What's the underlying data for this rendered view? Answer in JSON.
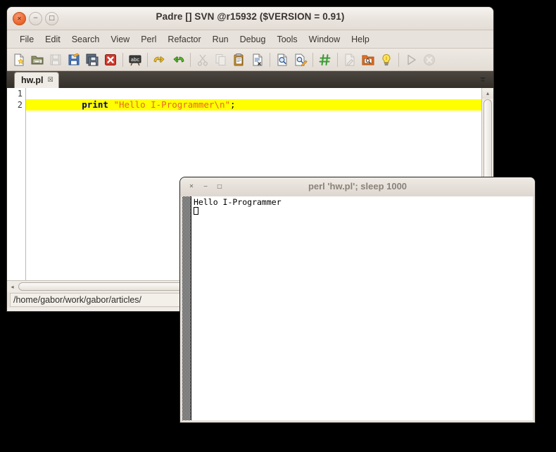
{
  "padre": {
    "title": "Padre [] SVN @r15932 ($VERSION = 0.91)",
    "window_buttons": [
      {
        "name": "close",
        "glyph": "✕"
      },
      {
        "name": "minimize",
        "glyph": "−"
      },
      {
        "name": "maximize",
        "glyph": "□"
      }
    ],
    "menus": [
      "File",
      "Edit",
      "Search",
      "View",
      "Perl",
      "Refactor",
      "Run",
      "Debug",
      "Tools",
      "Window",
      "Help"
    ],
    "toolbar": [
      {
        "icon": "new-file-icon",
        "label": "New",
        "enabled": true
      },
      {
        "icon": "open-folder-icon",
        "label": "Open",
        "enabled": true
      },
      {
        "icon": "save-icon",
        "label": "Save",
        "enabled": false
      },
      {
        "icon": "save-as-icon",
        "label": "Save As",
        "enabled": true
      },
      {
        "icon": "save-all-icon",
        "label": "Save All",
        "enabled": true
      },
      {
        "icon": "close-document-icon",
        "label": "Close",
        "enabled": true
      },
      {
        "separator": true
      },
      {
        "icon": "spell-check-icon",
        "label": "Spelling",
        "enabled": true
      },
      {
        "separator": true
      },
      {
        "icon": "undo-icon",
        "label": "Undo",
        "enabled": true
      },
      {
        "icon": "redo-icon",
        "label": "Redo",
        "enabled": true
      },
      {
        "separator": true
      },
      {
        "icon": "cut-icon",
        "label": "Cut",
        "enabled": false
      },
      {
        "icon": "copy-icon",
        "label": "Copy",
        "enabled": false
      },
      {
        "icon": "paste-icon",
        "label": "Paste",
        "enabled": true
      },
      {
        "icon": "delete-document-icon",
        "label": "Delete",
        "enabled": true
      },
      {
        "separator": true
      },
      {
        "icon": "find-icon",
        "label": "Find",
        "enabled": true
      },
      {
        "icon": "find-replace-icon",
        "label": "Replace",
        "enabled": true
      },
      {
        "separator": true
      },
      {
        "icon": "goto-line-icon",
        "label": "Goto Line",
        "enabled": true
      },
      {
        "separator": true
      },
      {
        "icon": "document-pen-icon",
        "label": "Doc Stats",
        "enabled": false
      },
      {
        "icon": "browse-folder-icon",
        "label": "Browse",
        "enabled": true
      },
      {
        "icon": "lightbulb-icon",
        "label": "Hints",
        "enabled": true
      },
      {
        "separator": true
      },
      {
        "icon": "run-icon",
        "label": "Run",
        "enabled": true
      },
      {
        "icon": "stop-icon",
        "label": "Stop",
        "enabled": false
      }
    ],
    "tabs": [
      {
        "label": "hw.pl",
        "close_glyph": "☒",
        "active": true
      }
    ],
    "tab_overflow_glyph": "▾",
    "editor": {
      "lines": [
        {
          "number": "1",
          "highlighted": false,
          "tokens": [
            {
              "text": "print",
              "type": "keyword"
            },
            {
              "text": " ",
              "type": "plain"
            },
            {
              "text": "\"Hello I-Programmer\\n\"",
              "type": "string"
            },
            {
              "text": ";",
              "type": "punctuation"
            }
          ]
        },
        {
          "number": "2",
          "highlighted": true,
          "tokens": []
        }
      ]
    },
    "scroll": {
      "v_up_glyph": "▴",
      "h_left_glyph": "◂",
      "h_right_glyph": "▸",
      "h_grip": "•••"
    },
    "statusbar": {
      "path": "/home/gabor/work/gabor/articles/"
    }
  },
  "terminal": {
    "title": "perl  'hw.pl'; sleep 1000",
    "window_buttons": [
      {
        "name": "close",
        "glyph": "✕"
      },
      {
        "name": "minimize",
        "glyph": "−"
      },
      {
        "name": "maximize",
        "glyph": "□"
      }
    ],
    "output": "Hello I-Programmer"
  },
  "colors": {
    "keyword": "#000080",
    "string": "#e8662a",
    "current_line": "#ffff00",
    "accent": "#ee6a33"
  }
}
